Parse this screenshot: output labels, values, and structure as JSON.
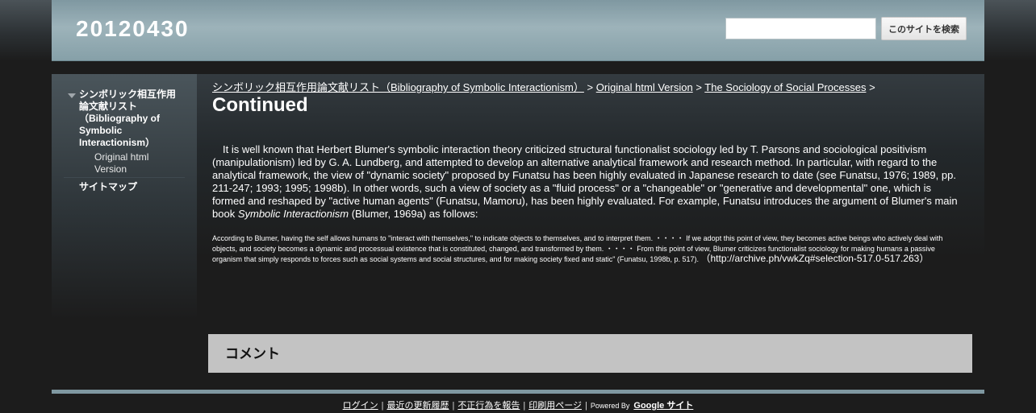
{
  "header": {
    "site_title": "20120430",
    "search_placeholder": "",
    "search_button": "このサイトを検索"
  },
  "sidebar": {
    "items": [
      {
        "label": "シンボリック相互作用論文献リスト（Bibliography of Symbolic Interactionism）"
      },
      {
        "label": "Original html Version"
      },
      {
        "label": "サイトマップ"
      }
    ]
  },
  "breadcrumb": {
    "items": [
      "シンボリック相互作用論文献リスト（Bibliography of Symbolic Interactionism）",
      "Original html Version",
      "The Sociology of Social Processes"
    ],
    "separator": ">"
  },
  "page": {
    "title": "Continued",
    "para_before": "　It is well known that Herbert Blumer's symbolic interaction theory criticized structural functionalist sociology led by T. Parsons and sociological positivism (manipulationism) led by G. A. Lundberg, and attempted to develop an alternative analytical framework and research method. In particular, with regard to the analytical framework, the view of \"dynamic society\" proposed by Funatsu has been highly evaluated in Japanese research to date (see Funatsu, 1976; 1989, pp. 211-247; 1993; 1995; 1998b). In other words, such a view of society as a \"fluid process\" or a \"changeable\" or \"generative and developmental\" one, which is formed and reshaped by \"active human agents\" (Funatsu, Mamoru), has been highly evaluated. For example, Funatsu introduces the argument of Blumer's main book ",
    "para_italic": "Symbolic Interactionism",
    "para_after": " (Blumer, 1969a) as follows:",
    "quote": "According to Blumer, having the self allows humans to \"interact with themselves,\" to indicate objects to themselves, and to interpret them. ・・・・ If we adopt this point of view, they becomes active beings who actively deal with objects, and society becomes a dynamic and processual existence that is constituted, changed, and transformed by them. ・・・・ From this point of view, Blumer criticizes functionalist sociology for making humans a passive organism that simply responds to forces such as social systems and social structures, and for making society fixed and static\" (Funatsu, 1998b, p. 517).",
    "quote_source": "（http://archive.ph/vwkZq#selection-517.0-517.263）"
  },
  "comments": {
    "title": "コメント"
  },
  "footer": {
    "links": [
      "ログイン",
      "最近の更新履歴",
      "不正行為を報告",
      "印刷用ページ"
    ],
    "separator": "|",
    "powered_by": "Powered By",
    "google_sites": "Google サイト"
  }
}
